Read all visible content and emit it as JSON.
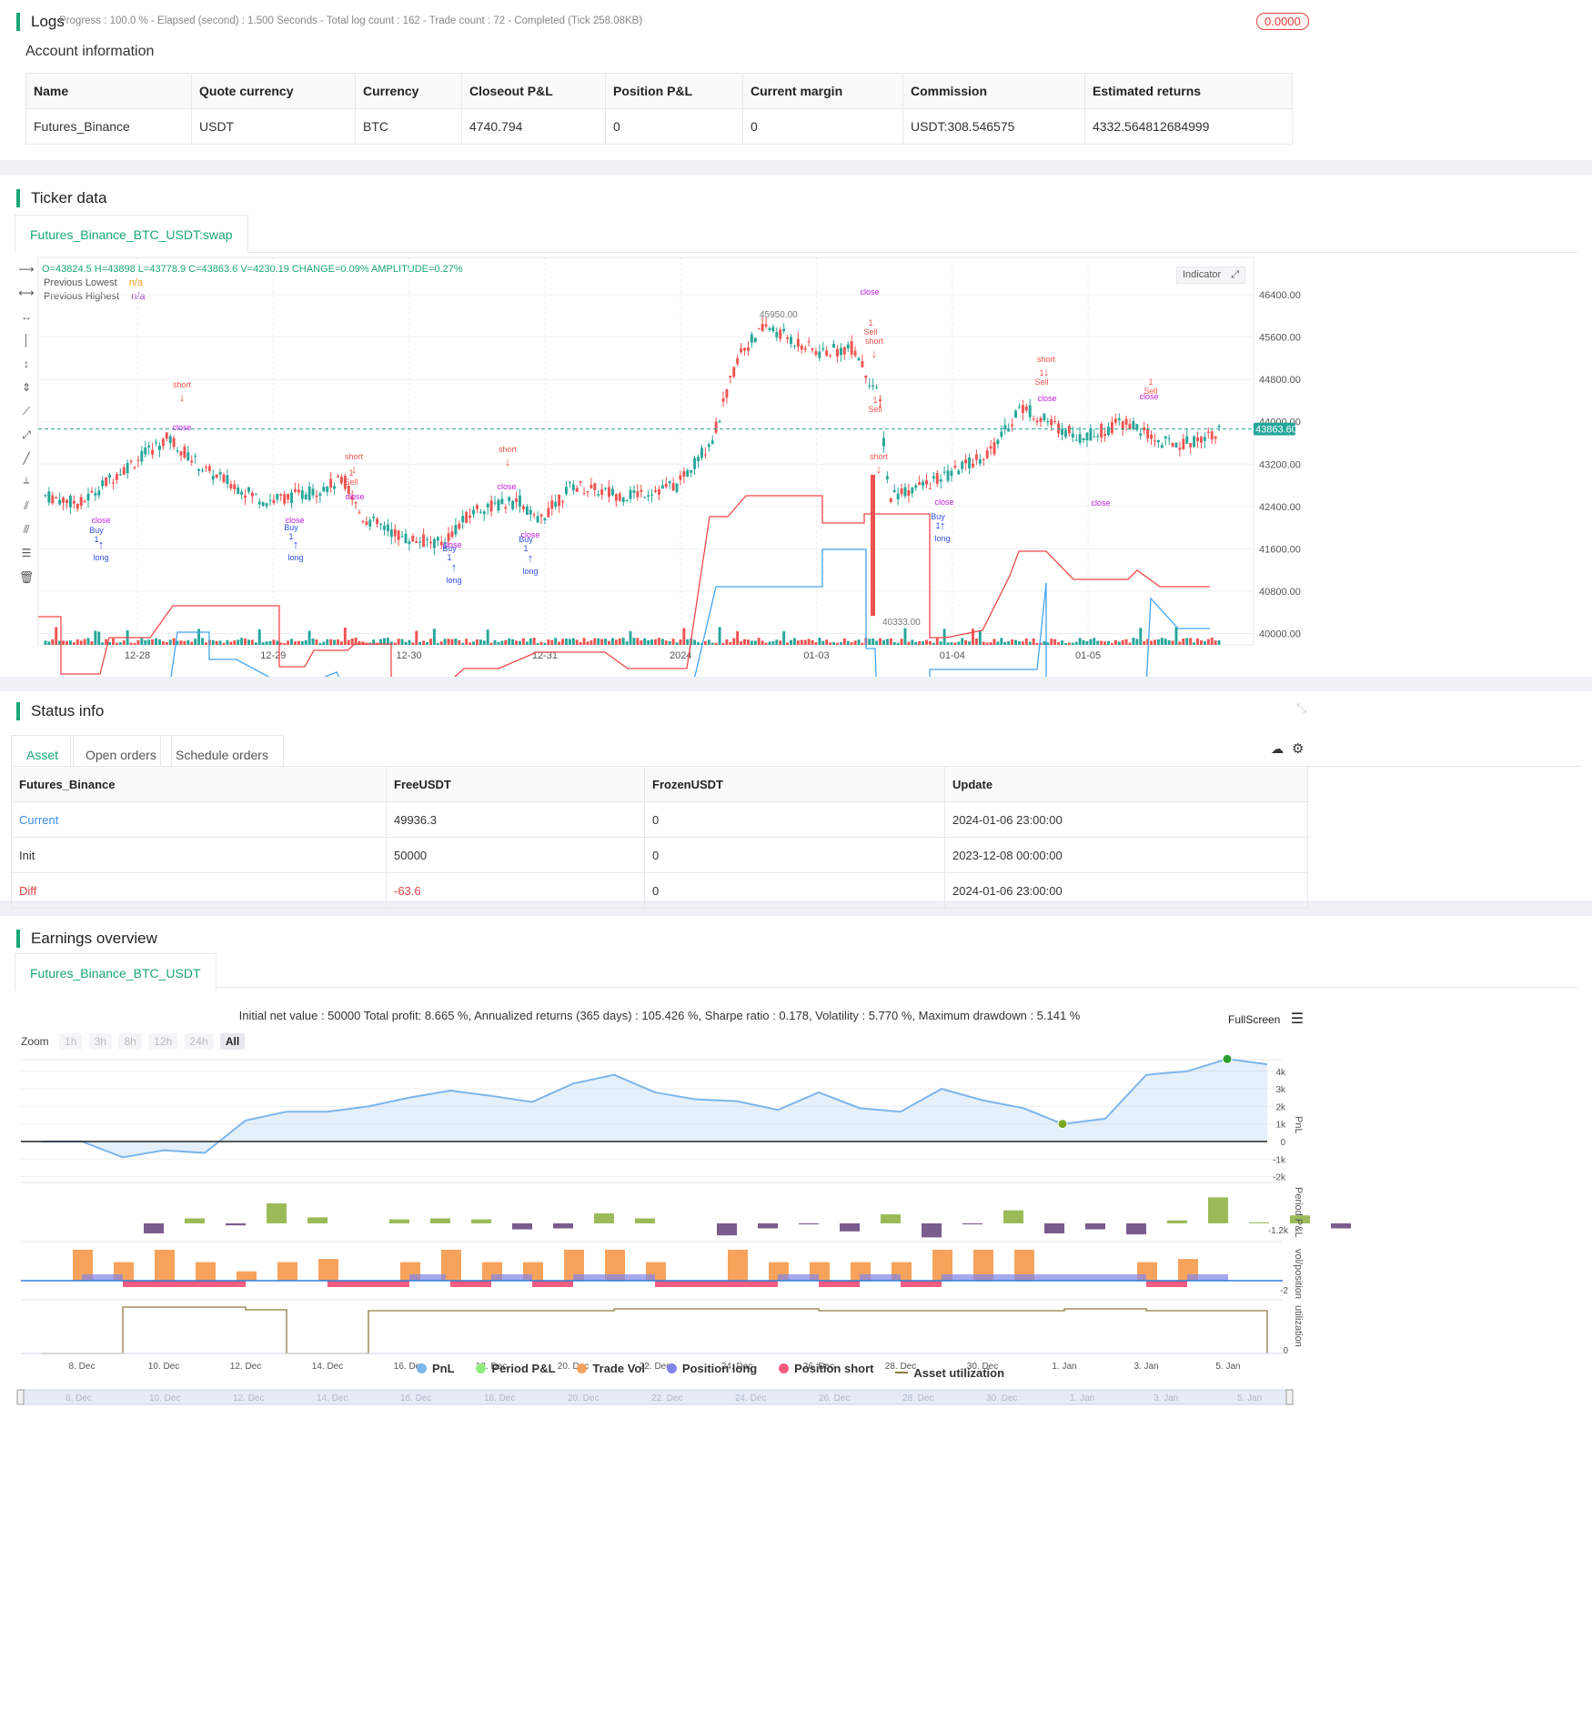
{
  "logs": {
    "title": "Logs",
    "progress": "- Progress : 100.0 % - Elapsed (second) : 1.500  Seconds - Total log count : 162 - Trade count : 72 - Completed (Tick 258.08KB)",
    "badge": "0.0000",
    "account_title": "Account information",
    "columns": [
      "Name",
      "Quote currency",
      "Currency",
      "Closeout P&L",
      "Position P&L",
      "Current margin",
      "Commission",
      "Estimated returns"
    ],
    "row": [
      "Futures_Binance",
      "USDT",
      "BTC",
      "4740.794",
      "0",
      "0",
      "USDT:308.546575",
      "4332.564812684999"
    ]
  },
  "ticker": {
    "title": "Ticker data",
    "tab": "Futures_Binance_BTC_USDT:swap",
    "ohlc": "O=43824.5 H=43898 L=43778.9 C=43863.6 V=4230.19 CHANGE=0.09% AMPLITUDE=0.27%",
    "legend": [
      {
        "label": "Previous Lowest",
        "value": "n/a",
        "color": "#f0a020"
      },
      {
        "label": "Previous Highest",
        "value": "n/a",
        "color": "#a040d0"
      }
    ],
    "indicator_btn": "Indicator",
    "price_ticks": [
      "46400.00",
      "45600.00",
      "44800.00",
      "44000.00",
      "43200.00",
      "42400.00",
      "41600.00",
      "40800.00",
      "40000.00"
    ],
    "date_ticks": [
      "12-28",
      "12-29",
      "12-30",
      "12-31",
      "2024",
      "01-03",
      "01-04",
      "01-05"
    ],
    "current_price": "43863.60",
    "high_label": "45950.00",
    "low_label": "40333.00",
    "colors": {
      "up": "#26a69a",
      "down": "#ef5350",
      "highest": "#f0474a",
      "lowest": "#42a5f5",
      "buy": "#3050e0",
      "close": "#c020e0"
    },
    "signal_words": {
      "short": "short",
      "long": "long",
      "buy": "Buy",
      "sell": "Sell",
      "close": "close",
      "one": "1"
    }
  },
  "status": {
    "title": "Status info",
    "tabs": [
      "Asset",
      "Open orders",
      "Schedule orders"
    ],
    "columns": [
      "Futures_Binance",
      "FreeUSDT",
      "FrozenUSDT",
      "Update"
    ],
    "rows": [
      [
        "Current",
        "49936.3",
        "0",
        "2024-01-06 23:00:00"
      ],
      [
        "Init",
        "50000",
        "0",
        "2023-12-08 00:00:00"
      ],
      [
        "Diff",
        "-63.6",
        "0",
        "2024-01-06 23:00:00"
      ]
    ]
  },
  "earnings": {
    "title": "Earnings overview",
    "tab": "Futures_Binance_BTC_USDT",
    "summary": "Initial net value : 50000 Total profit: 8.665 %, Annualized returns (365 days) : 105.426 %, Sharpe ratio : 0.178, Volatility : 5.770 %, Maximum drawdown : 5.141 %",
    "fullscreen": "FullScreen",
    "zoom_label": "Zoom",
    "zoom_buttons": [
      "1h",
      "3h",
      "8h",
      "12h",
      "24h",
      "All"
    ],
    "pnl_ticks": [
      "4k",
      "3k",
      "2k",
      "1k",
      "0",
      "-1k",
      "-2k"
    ],
    "axis_labels": [
      "PnL",
      "Period P&L",
      "vol/position",
      "utilization"
    ],
    "period_tick": "-1.2k",
    "vol_tick": "-2",
    "util_tick": "0",
    "date_ticks": [
      "8. Dec",
      "10. Dec",
      "12. Dec",
      "14. Dec",
      "16. Dec",
      "18. Dec",
      "20. Dec",
      "22. Dec",
      "24. Dec",
      "26. Dec",
      "28. Dec",
      "30. Dec",
      "1. Jan",
      "3. Jan",
      "5. Jan"
    ],
    "legend": [
      {
        "label": "PnL",
        "color": "#7cb5ec"
      },
      {
        "label": "Period P&L",
        "color": "#90ed7d"
      },
      {
        "label": "Trade Vol",
        "color": "#f7a35c"
      },
      {
        "label": "Position long",
        "color": "#8085e9"
      },
      {
        "label": "Position short",
        "color": "#f15c80"
      },
      {
        "label": "Asset utilization",
        "color": "#8d7b3f"
      }
    ]
  }
}
